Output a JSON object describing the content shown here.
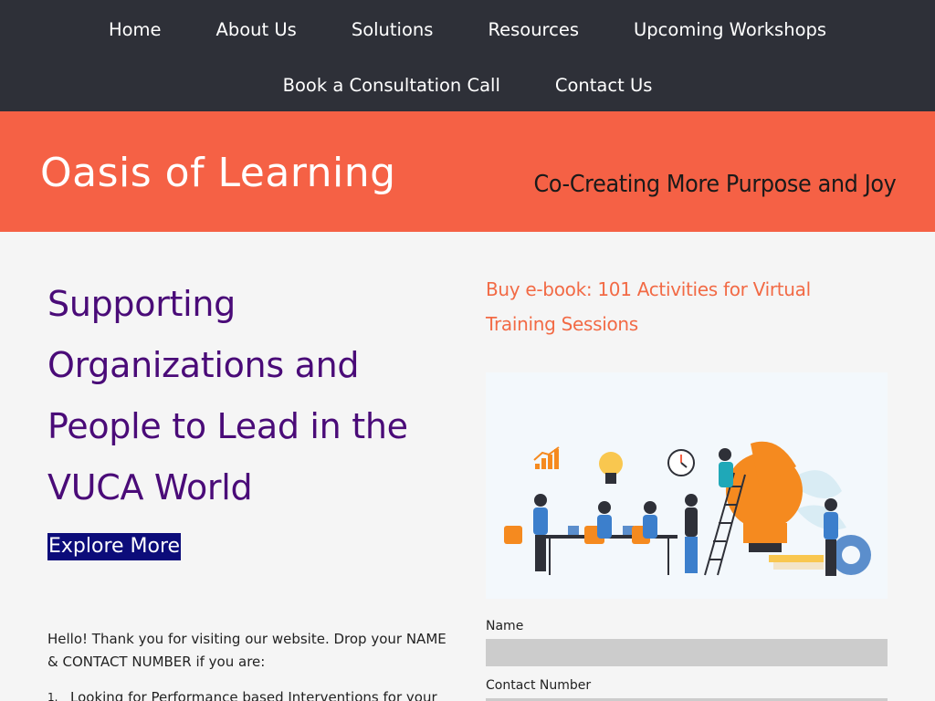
{
  "nav": {
    "row1": [
      {
        "label": "Home"
      },
      {
        "label": "About Us"
      },
      {
        "label": "Solutions"
      },
      {
        "label": "Resources"
      },
      {
        "label": "Upcoming Workshops"
      }
    ],
    "row2": [
      {
        "label": "Book a Consultation Call"
      },
      {
        "label": "Contact Us"
      }
    ]
  },
  "banner": {
    "title": "Oasis of Learning",
    "tagline": "Co-Creating More Purpose and Joy"
  },
  "hero": {
    "heading": "Supporting Organizations and People to Lead in the VUCA World",
    "button": "Explore More"
  },
  "intro": {
    "text": "Hello! Thank you for visiting our website. Drop your NAME & CONTACT NUMBER if you are:",
    "list": [
      {
        "num": "1.",
        "text": "Looking for Performance based Interventions for your"
      }
    ]
  },
  "ebook": {
    "link": "Buy e-book: 101 Activities for Virtual Training Sessions"
  },
  "form": {
    "name_label": "Name",
    "contact_label": "Contact Number"
  },
  "colors": {
    "nav_bg": "#2e3038",
    "banner_bg": "#f56145",
    "hero_text": "#4a0b78",
    "button_bg": "#0c0c7a",
    "link": "#f26a45",
    "page_bg": "#f5f5f5"
  }
}
